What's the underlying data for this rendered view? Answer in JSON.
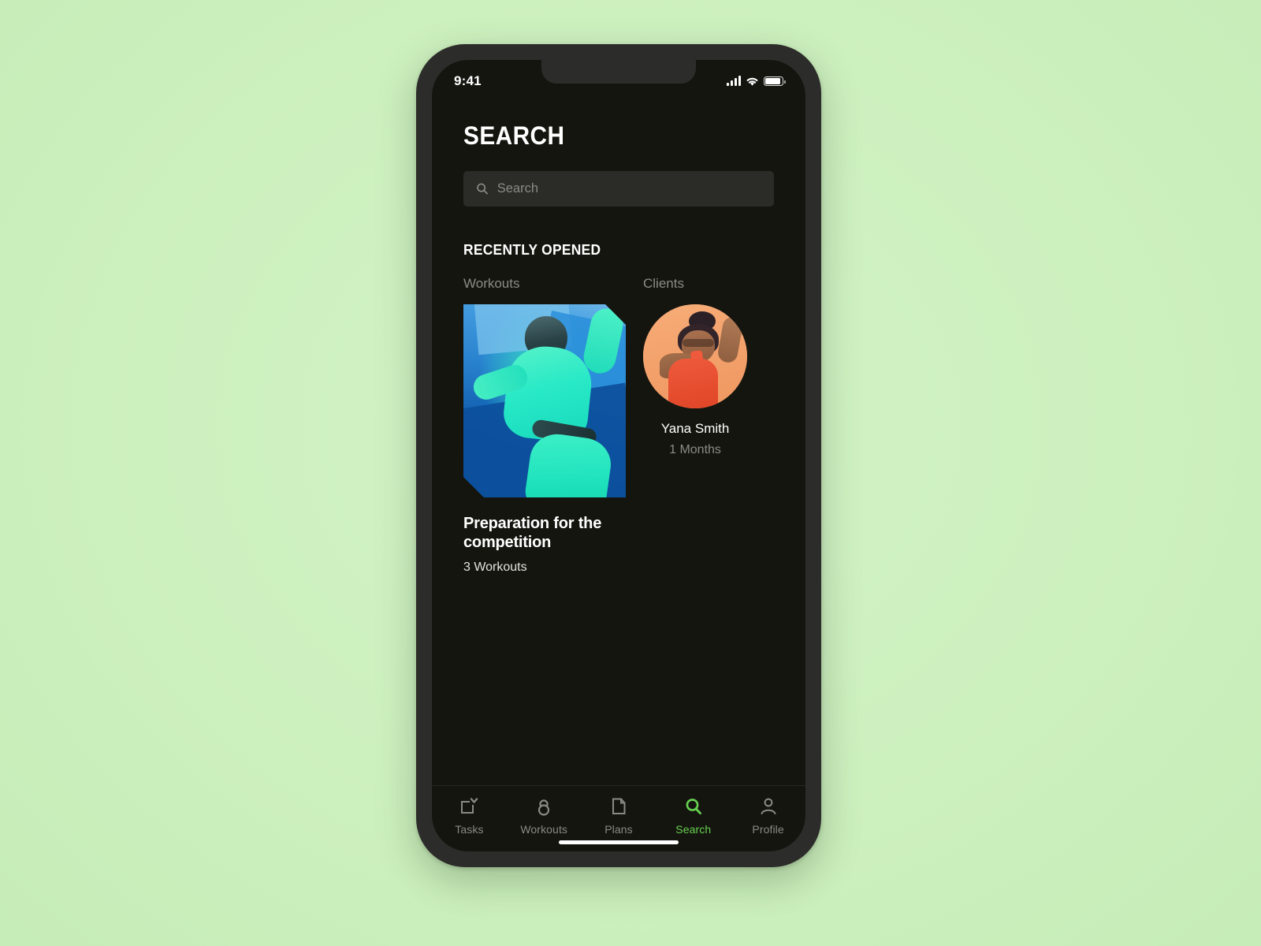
{
  "status_bar": {
    "time": "9:41",
    "cellular_icon": "signal-bars-icon",
    "wifi_icon": "wifi-icon",
    "battery_icon": "battery-icon"
  },
  "header": {
    "title": "SEARCH"
  },
  "search": {
    "icon": "search-icon",
    "value": "",
    "placeholder": "Search"
  },
  "recently_opened": {
    "section_title": "RECENTLY OPENED",
    "workouts_label": "Workouts",
    "clients_label": "Clients",
    "workout_card": {
      "title": "Preparation for the competition",
      "subtitle": "3 Workouts",
      "thumbnail_alt": "athlete-stretching-photo"
    },
    "client_card": {
      "name": "Yana Smith",
      "duration": "1 Months",
      "avatar_alt": "client-portrait-photo"
    }
  },
  "tab_bar": {
    "active_tab": "Search",
    "active_color": "#66d150",
    "inactive_color": "#8a8a84",
    "tabs": [
      {
        "label": "Tasks",
        "icon": "tasks-check-icon",
        "active": false
      },
      {
        "label": "Workouts",
        "icon": "kettlebell-icon",
        "active": false
      },
      {
        "label": "Plans",
        "icon": "document-icon",
        "active": false
      },
      {
        "label": "Search",
        "icon": "search-icon",
        "active": true
      },
      {
        "label": "Profile",
        "icon": "person-icon",
        "active": false
      }
    ]
  },
  "theme": {
    "page_background": "#cdf0bf",
    "screen_background": "#15150f",
    "frame_color": "#2c2c2a",
    "accent_green": "#66d150",
    "muted_text": "#8c8c86"
  }
}
